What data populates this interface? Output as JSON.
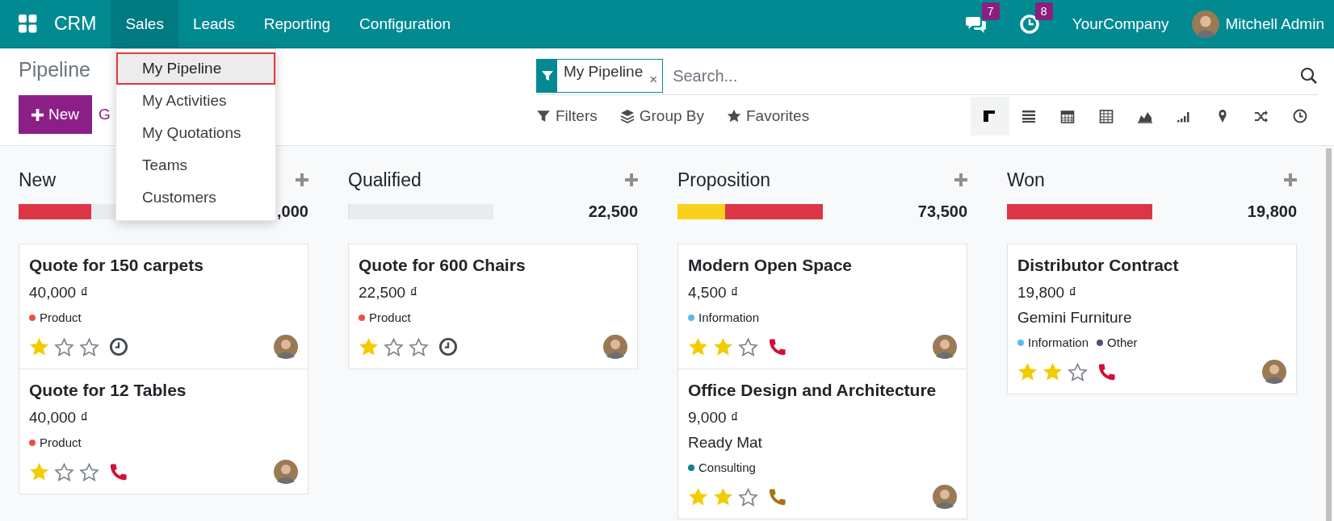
{
  "navbar": {
    "app": "CRM",
    "menus": [
      {
        "label": "Sales",
        "selected": true
      },
      {
        "label": "Leads",
        "selected": false
      },
      {
        "label": "Reporting",
        "selected": false
      },
      {
        "label": "Configuration",
        "selected": false
      }
    ],
    "messages_count": "7",
    "activities_count": "8",
    "company": "YourCompany",
    "user": "Mitchell Admin"
  },
  "dropdown": {
    "items": [
      {
        "label": "My Pipeline",
        "selected": true
      },
      {
        "label": "My Activities",
        "selected": false
      },
      {
        "label": "My Quotations",
        "selected": false
      },
      {
        "label": "Teams",
        "selected": false
      },
      {
        "label": "Customers",
        "selected": false
      }
    ]
  },
  "control_panel": {
    "title": "Pipeline",
    "new_button": "New",
    "generate_link": "G",
    "facet": "My Pipeline",
    "facet_remove": "×",
    "search": {
      "placeholder": "Search..."
    },
    "filters": "Filters",
    "group_by": "Group By",
    "favorites": "Favorites",
    "views": [
      {
        "kind": "kanban",
        "selected": true
      },
      {
        "kind": "list",
        "selected": false
      },
      {
        "kind": "calendar",
        "selected": false
      },
      {
        "kind": "pivot",
        "selected": false
      },
      {
        "kind": "graph",
        "selected": false
      },
      {
        "kind": "cohort",
        "selected": false
      },
      {
        "kind": "map",
        "selected": false
      },
      {
        "kind": "dashboard",
        "selected": false
      },
      {
        "kind": "activity",
        "selected": false
      }
    ]
  },
  "columns": [
    {
      "name": "New",
      "total": ",000",
      "segments": [
        {
          "color": "#dc3545",
          "level": 0.5
        }
      ],
      "cards": [
        {
          "title": "Quote for 150 carpets",
          "amount": "40,000 ₫",
          "tags": [
            {
              "label": "Product",
              "color": "#e8524a"
            }
          ],
          "stars": 1,
          "activity": {
            "kind": "clock",
            "color": "#444b52"
          }
        },
        {
          "title": "Quote for 12 Tables",
          "amount": "40,000 ₫",
          "tags": [
            {
              "label": "Product",
              "color": "#e8524a"
            }
          ],
          "stars": 1,
          "activity": {
            "kind": "phone",
            "color": "#d0103a"
          }
        }
      ]
    },
    {
      "name": "Qualified",
      "total": "22,500",
      "segments": [
        {
          "level": 0
        }
      ],
      "cards": [
        {
          "title": "Quote for 600 Chairs",
          "amount": "22,500 ₫",
          "tags": [
            {
              "label": "Product",
              "color": "#e8524a"
            }
          ],
          "stars": 1,
          "activity": {
            "kind": "clock",
            "color": "#444b52"
          }
        }
      ]
    },
    {
      "name": "Proposition",
      "total": "73,500",
      "segments": [
        {
          "color": "#f9d11d",
          "level": 0.33
        },
        {
          "color": "#dc3545",
          "level": 0.67
        }
      ],
      "cards": [
        {
          "title": "Modern Open Space",
          "amount": "4,500 ₫",
          "tags": [
            {
              "label": "Information",
              "color": "#5bbce8"
            }
          ],
          "stars": 2,
          "activity": {
            "kind": "phone",
            "color": "#d0103a"
          }
        },
        {
          "title": "Office Design and Architecture",
          "amount": "9,000 ₫",
          "customer": "Ready Mat",
          "tags": [
            {
              "label": "Consulting",
              "color": "#127f8c"
            }
          ],
          "stars": 2,
          "activity": {
            "kind": "phone",
            "color": "#a8731a"
          }
        }
      ]
    },
    {
      "name": "Won",
      "total": "19,800",
      "segments": [
        {
          "color": "#dc3545",
          "level": 1
        }
      ],
      "cards": [
        {
          "title": "Distributor Contract",
          "amount": "19,800 ₫",
          "customer": "Gemini Furniture",
          "tags": [
            {
              "label": "Information",
              "color": "#5bbce8"
            },
            {
              "label": "Other",
              "color": "#505473"
            }
          ],
          "stars": 2,
          "activity": {
            "kind": "phone",
            "color": "#d0103a"
          }
        }
      ]
    }
  ]
}
